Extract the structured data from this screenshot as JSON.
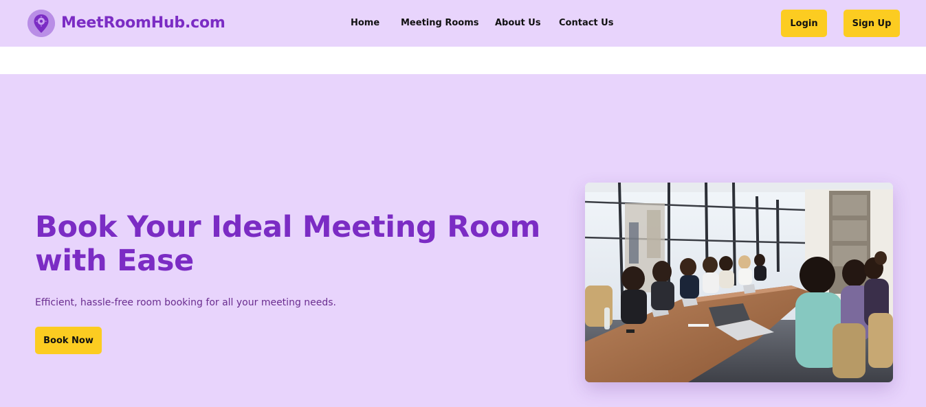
{
  "brand": {
    "name": "MeetRoomHub.com",
    "logo_icon": "location-pin-icon"
  },
  "nav": {
    "links": [
      "Home",
      "Meeting Rooms",
      "About Us",
      "Contact Us"
    ],
    "login_label": "Login",
    "signup_label": "Sign Up"
  },
  "hero": {
    "title": "Book Your Ideal Meeting Room with Ease",
    "subtitle": "Efficient, hassle-free room booking for all your meeting needs.",
    "cta_label": "Book Now",
    "image_description": "meeting-room-photo"
  },
  "colors": {
    "background": "#e8d4fc",
    "brand_purple": "#7b2cc4",
    "accent_yellow": "#fccc21"
  }
}
